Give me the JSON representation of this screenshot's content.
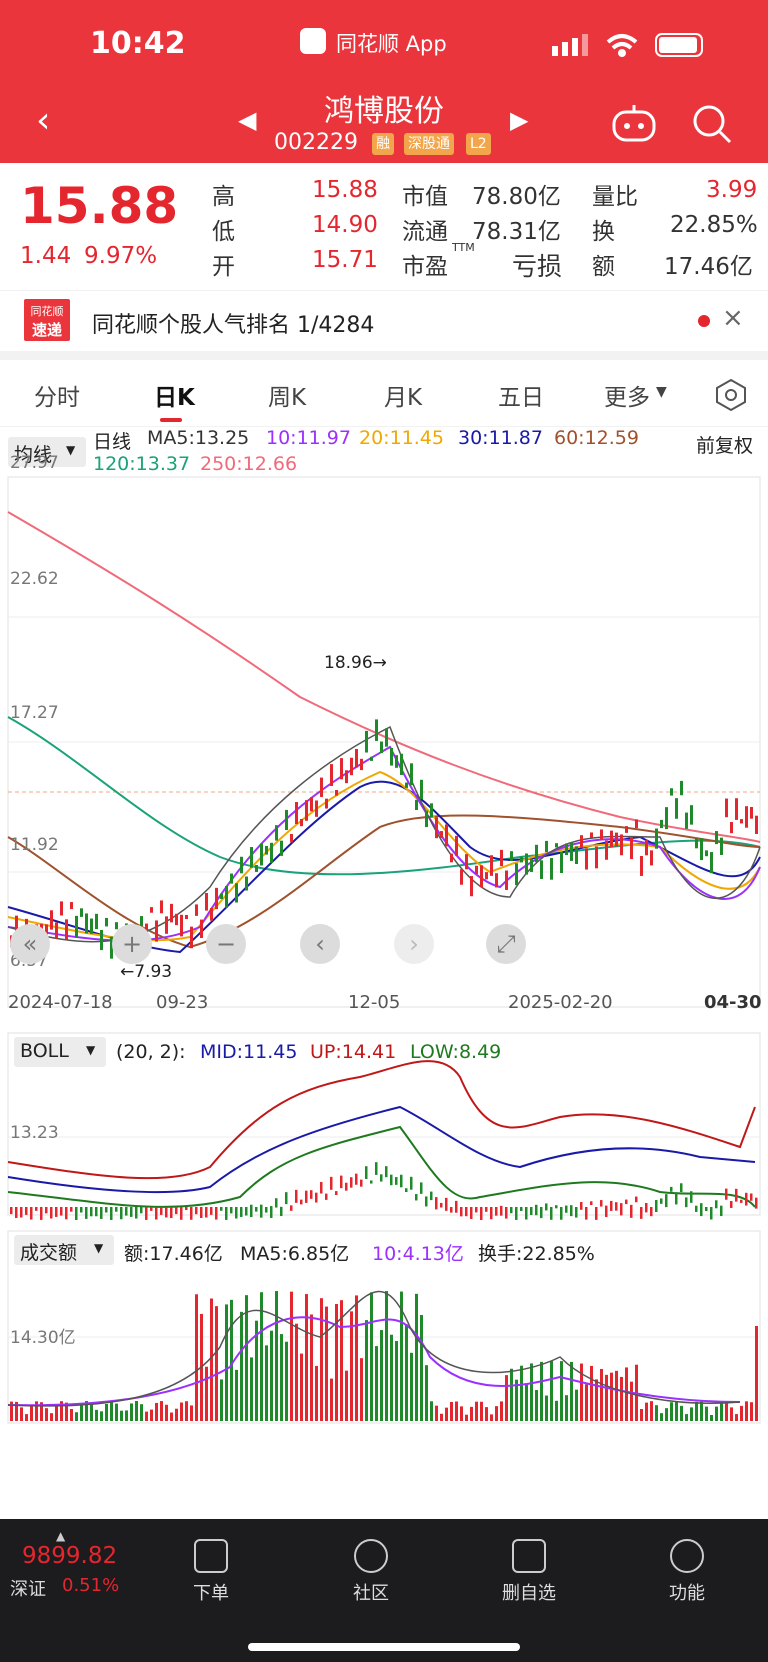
{
  "status": {
    "time": "10:42",
    "app": "同花顺 App"
  },
  "header": {
    "name": "鸿博股份",
    "code": "002229",
    "tags": [
      "融",
      "深股通",
      "L2"
    ]
  },
  "quote": {
    "price": "15.88",
    "change": "1.44",
    "pct": "9.97%",
    "fields": [
      {
        "label": "高",
        "value": "15.88"
      },
      {
        "label": "低",
        "value": "14.90"
      },
      {
        "label": "开",
        "value": "15.71"
      }
    ],
    "fields2": [
      {
        "label": "市值",
        "value": "78.80亿"
      },
      {
        "label": "流通",
        "value": "78.31亿"
      },
      {
        "label": "市盈",
        "sup": "TTM",
        "value": "亏损"
      }
    ],
    "fields3": [
      {
        "label": "量比",
        "value": "3.99"
      },
      {
        "label": "换",
        "value": "22.85%"
      },
      {
        "label": "额",
        "value": "17.46亿"
      }
    ]
  },
  "rank": {
    "logo_top": "同花顺",
    "logo_bottom": "速递",
    "text": "同花顺个股人气排名 1/4284"
  },
  "tabs": [
    "分时",
    "日K",
    "周K",
    "月K",
    "五日",
    "更多"
  ],
  "ma_bar": {
    "selector": "均线",
    "period": "日线",
    "adj": "前复权",
    "items": [
      {
        "text": "MA5:13.25",
        "color": "#333333"
      },
      {
        "text": "10:11.97",
        "color": "#9b30ff"
      },
      {
        "text": "20:11.45",
        "color": "#f0a800"
      },
      {
        "text": "30:11.87",
        "color": "#1a1aa8"
      },
      {
        "text": "60:12.59",
        "color": "#a0522d"
      },
      {
        "text": "120:13.37",
        "color": "#1aa37a"
      },
      {
        "text": "250:12.66",
        "color": "#f06a7a"
      }
    ]
  },
  "kline": {
    "y_ticks": [
      "27.97",
      "22.62",
      "17.27",
      "11.92",
      "6.57"
    ],
    "high_label": "18.96→",
    "low_label": "←7.93",
    "x_ticks": [
      "2024-07-18",
      "09-23",
      "12-05",
      "2025-02-20",
      "04-30"
    ]
  },
  "boll": {
    "selector": "BOLL",
    "params": "(20, 2):",
    "mid": "MID:11.45",
    "up": "UP:14.41",
    "low": "LOW:8.49",
    "tick": "13.23"
  },
  "volume": {
    "selector": "成交额",
    "amount": "额:17.46亿",
    "ma5": "MA5:6.85亿",
    "ma10": "10:4.13亿",
    "turnover": "换手:22.85%",
    "tick": "14.30亿"
  },
  "bottom": {
    "index_value": "9899.82",
    "index_name": "深证",
    "index_pct": "0.51%",
    "nav": [
      "下单",
      "社区",
      "删自选",
      "功能"
    ]
  },
  "colors": {
    "brand": "#e9353b",
    "up": "#e4262e",
    "down": "#1f8a2a"
  }
}
